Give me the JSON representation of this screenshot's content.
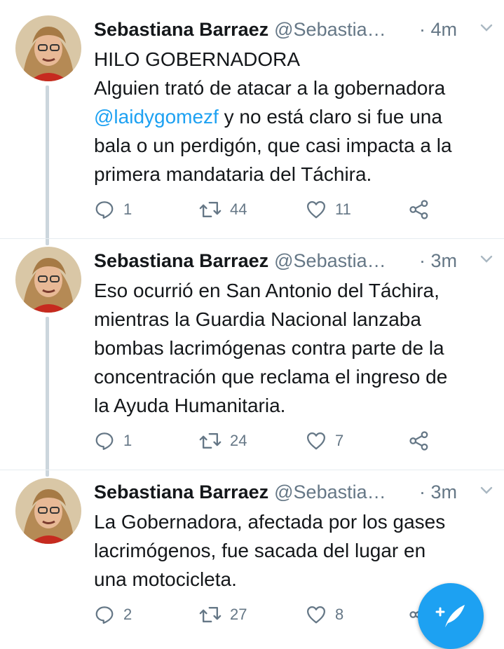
{
  "tweets": [
    {
      "name": "Sebastiana Barraez",
      "handle": "@Sebastia…",
      "time": "· 4m",
      "text_lines": [
        "HILO GOBERNADORA",
        "Alguien trató de atacar a la gobernadora"
      ],
      "mention": "@laidygomezf",
      "text_after_mention": " y no está claro si fue una\nbala o un perdigón, que casi impacta a la\nprimera mandataria del Táchira.",
      "replies": "1",
      "retweets": "44",
      "likes": "11"
    },
    {
      "name": "Sebastiana Barraez",
      "handle": "@Sebastia…",
      "time": "· 3m",
      "text": "Eso ocurrió en San Antonio del Táchira,\nmientras la Guardia Nacional lanzaba\nbombas lacrimógenas contra parte de la\nconcentración que reclama el ingreso de\nla Ayuda Humanitaria.",
      "replies": "1",
      "retweets": "24",
      "likes": "7"
    },
    {
      "name": "Sebastiana Barraez",
      "handle": "@Sebastia…",
      "time": "· 3m",
      "text": "La Gobernadora, afectada por los gases\nlacrimógenos, fue sacada del lugar en\nuna motocicleta.",
      "replies": "2",
      "retweets": "27",
      "likes": "8"
    }
  ],
  "icons": {
    "reply": "reply-icon",
    "retweet": "retweet-icon",
    "like": "heart-icon",
    "share": "share-icon",
    "menu": "chevron-down-icon",
    "compose": "compose-tweet-icon"
  },
  "colors": {
    "accent": "#1da1f2",
    "text": "#14171a",
    "secondary": "#657786",
    "thread_line": "#ccd6dd"
  }
}
